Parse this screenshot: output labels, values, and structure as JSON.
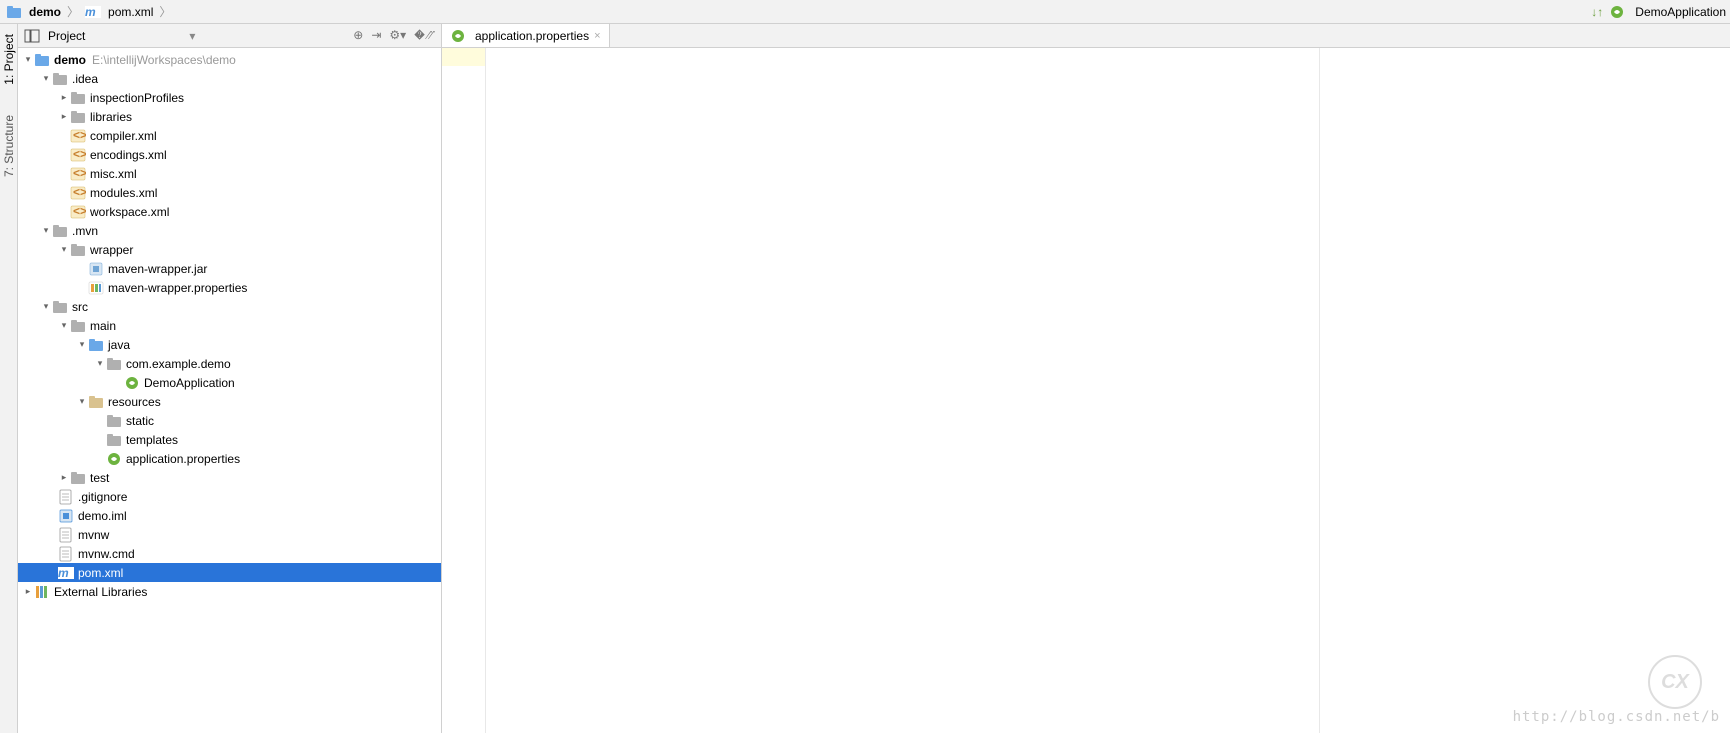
{
  "breadcrumb": {
    "items": [
      {
        "icon": "folder-blue",
        "label": "demo"
      },
      {
        "icon": "maven",
        "label": "pom.xml"
      }
    ]
  },
  "topright": {
    "sort_icon": "sort-icon",
    "run_label": "DemoApplication"
  },
  "gutter_tabs": {
    "project": "1: Project",
    "structure": "7: Structure"
  },
  "project_panel": {
    "title": "Project",
    "actions": {
      "target": "target-icon",
      "collapse": "collapse-icon",
      "gear": "gear-icon",
      "hide": "hide-icon"
    }
  },
  "tree": {
    "root": {
      "name": "demo",
      "path": "E:\\intellijWorkspaces\\demo"
    },
    "idea": {
      "name": ".idea"
    },
    "inspectionProfiles": {
      "name": "inspectionProfiles"
    },
    "libraries": {
      "name": "libraries"
    },
    "compiler": {
      "name": "compiler.xml"
    },
    "encodings": {
      "name": "encodings.xml"
    },
    "misc": {
      "name": "misc.xml"
    },
    "modules": {
      "name": "modules.xml"
    },
    "workspace": {
      "name": "workspace.xml"
    },
    "mvn": {
      "name": ".mvn"
    },
    "wrapper": {
      "name": "wrapper"
    },
    "mavenwrapperjar": {
      "name": "maven-wrapper.jar"
    },
    "mavenwrapperprops": {
      "name": "maven-wrapper.properties"
    },
    "src": {
      "name": "src"
    },
    "main": {
      "name": "main"
    },
    "java": {
      "name": "java"
    },
    "pkg": {
      "name": "com.example.demo"
    },
    "demoapp": {
      "name": "DemoApplication"
    },
    "resources": {
      "name": "resources"
    },
    "static": {
      "name": "static"
    },
    "templates": {
      "name": "templates"
    },
    "appprops": {
      "name": "application.properties"
    },
    "test": {
      "name": "test"
    },
    "gitignore": {
      "name": ".gitignore"
    },
    "demoiml": {
      "name": "demo.iml"
    },
    "mvnw": {
      "name": "mvnw"
    },
    "mvnwcmd": {
      "name": "mvnw.cmd"
    },
    "pom": {
      "name": "pom.xml"
    },
    "extlib": {
      "name": "External Libraries"
    }
  },
  "editor_tab": {
    "label": "application.properties"
  },
  "watermark": "http://blog.csdn.net/b"
}
